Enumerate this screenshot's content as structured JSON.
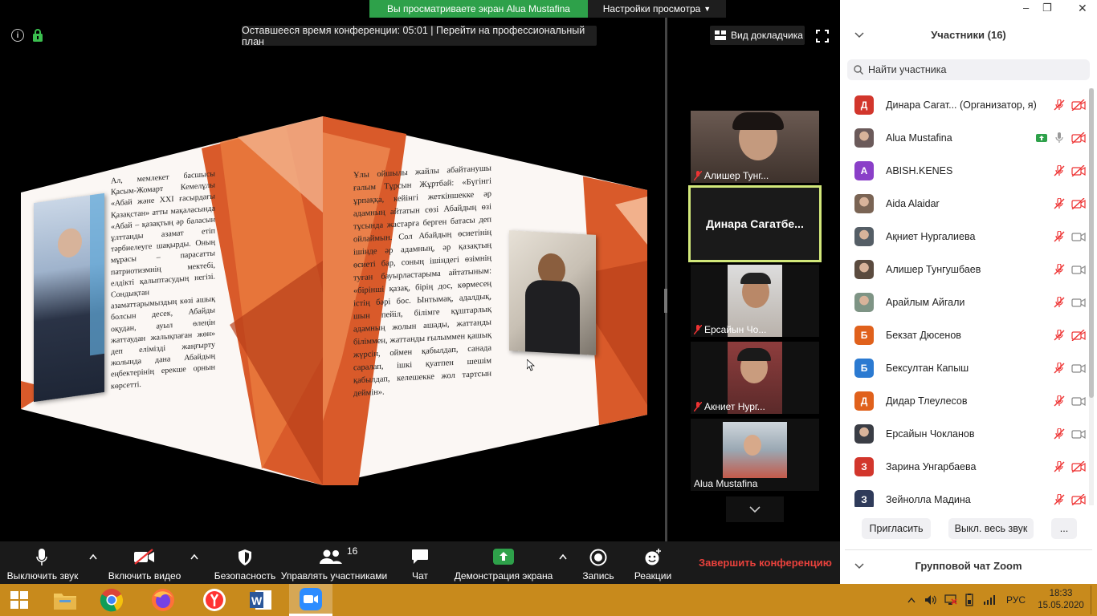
{
  "banner": {
    "sharing_text": "Вы просматриваете экран Alua Mustafina",
    "view_settings_label": "Настройки просмотра"
  },
  "meeting": {
    "time_remaining_text": "Оставшееся время конференции: 05:01 | Перейти на профессиональный план",
    "speaker_view_label": "Вид докладчика"
  },
  "slide": {
    "left_text": "Ал, мемлекет басшысы Қасым-Жомарт Кемелұлы «Абай және XXI ғасырдағы Қазақстан» атты мақаласында «Абай – қазақтың әр баласын ұлттанды азамат етіп тәрбиелеуге шақырды. Оның мұрасы – парасатты патриотизмнің мектебі, елдікті қалыптасудың негізі. Сондықтан азаматтарымыздың көзі ашық болсын десек, Абайды оқудан, ауыл өлеңін жаттаудан жалықпаған жөн» деп елімізді жаңғырту жолында дана Абайдың еңбектерінің ерекше орнын көрсетті.",
    "right_text": "Ұлы ойшылы жайлы абайтанушы ғалым Тұрсын Жұртбай: «Бүгінгі ұрпаққа, кейінгі жеткіншекке әр адамның айтатын сөзі Абайдың өзі тұсында жастарға берген батасы деп ойлаймын. Сол Абайдың өсиетінің ішінде әр адамның, әр қазақтың өсиеті бар, соның ішіндегі өзімнің туған бауырластарыма айтатыным: «бірінші қазақ, бірің дос, көрмесең істің бәрі бос. Ынтымақ, адалдық, шын пейіл, білімге құштарлық адамның жолын ашады, жаттанды біліммен, жаттанды ғылыммен қашық жүрсін, оймен қабылдап, санада саралап, ішкі қуатпен шешім қабылдап, келешекке жол тартсын деймін»."
  },
  "gallery": {
    "tiles": [
      {
        "name": "Алишер Тунг..."
      },
      {
        "name": "Динара  Сагатбе..."
      },
      {
        "name": "Ерсайын Чо..."
      },
      {
        "name": "Акниет Нург..."
      },
      {
        "name": "Alua Mustafina"
      }
    ]
  },
  "participants": {
    "title": "Участники (16)",
    "search_placeholder": "Найти участника",
    "list": [
      {
        "initial": "Д",
        "color": "#d2362c",
        "name": "Динара Сагат... (Организатор, я)",
        "mic": "off",
        "video": "off"
      },
      {
        "initial": "",
        "color": "#6b5a5a",
        "name": "Alua Mustafina",
        "mic": "on",
        "video": "off",
        "sharing": true
      },
      {
        "initial": "A",
        "color": "#8a3fc8",
        "name": "ABISH.KENES",
        "mic": "off",
        "video": "off"
      },
      {
        "initial": "",
        "color": "#7a6454",
        "name": "Aida Alaidar",
        "mic": "off",
        "video": "off"
      },
      {
        "initial": "",
        "color": "#555e66",
        "name": "Ақниет Нургалиева",
        "mic": "off",
        "video": "on"
      },
      {
        "initial": "",
        "color": "#5b4b3f",
        "name": "Алишер Тунгушбаев",
        "mic": "off",
        "video": "on"
      },
      {
        "initial": "",
        "color": "#7e9485",
        "name": "Арайлым Айгали",
        "mic": "off",
        "video": "on"
      },
      {
        "initial": "Б",
        "color": "#e0611c",
        "name": "Бекзат Дюсенов",
        "mic": "off",
        "video": "off"
      },
      {
        "initial": "Б",
        "color": "#2b7ad1",
        "name": "Бексултан Капыш",
        "mic": "off",
        "video": "on"
      },
      {
        "initial": "Д",
        "color": "#e0611c",
        "name": "Дидар Тлеулесов",
        "mic": "off",
        "video": "on"
      },
      {
        "initial": "",
        "color": "#3a3d45",
        "name": "Ерсайын Чокланов",
        "mic": "off",
        "video": "on"
      },
      {
        "initial": "З",
        "color": "#d2362c",
        "name": "Зарина Унгарбаева",
        "mic": "off",
        "video": "off"
      },
      {
        "initial": "З",
        "color": "#2f3b5a",
        "name": "Зейнолла Мадина",
        "mic": "off",
        "video": "off"
      }
    ],
    "invite_label": "Пригласить",
    "mute_all_label": "Выкл. весь звук",
    "more_label": "...",
    "chat_title": "Групповой чат Zoom"
  },
  "toolbar": {
    "mute_label": "Выключить звук",
    "video_label": "Включить видео",
    "security_label": "Безопасность",
    "participants_label": "Управлять участниками",
    "participants_count": "16",
    "chat_label": "Чат",
    "share_label": "Демонстрация экрана",
    "record_label": "Запись",
    "reactions_label": "Реакции",
    "end_label": "Завершить конференцию"
  },
  "taskbar": {
    "lang": "РУС",
    "time": "18:33",
    "date": "15.05.2020"
  },
  "colors": {
    "accent_green": "#2ea14a",
    "end_red": "#e8413c",
    "active_border": "#d2e87a",
    "taskbar": "#c88a1c"
  }
}
